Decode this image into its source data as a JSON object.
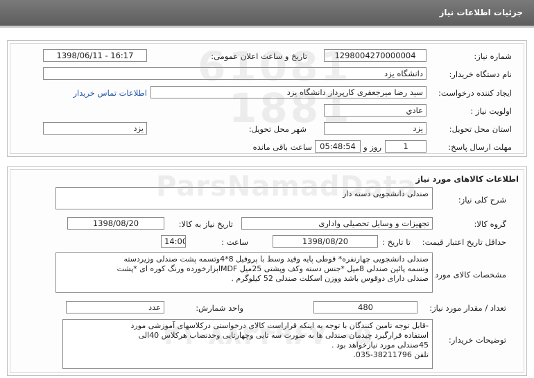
{
  "header": {
    "title": "جزئیات اطلاعات نیاز"
  },
  "info": {
    "need_number_label": "شماره نیاز:",
    "need_number": "1298004270000004",
    "announce_label": "تاریخ و ساعت اعلان عمومی:",
    "announce_value": "1398/06/11 - 16:17",
    "buyer_label": "نام دستگاه خریدار:",
    "buyer_value": "دانشگاه یزد",
    "creator_label": "ایجاد کننده درخواست:",
    "creator_value": "سید رضا میرجعفری کارپرداز دانشگاه یزد",
    "contact_link": "اطلاعات تماس خریدار",
    "priority_label": "اولویت نیاز :",
    "priority_value": "عادي",
    "province_label": "استان محل تحویل:",
    "province_value": "یزد",
    "city_label": "شهر محل تحویل:",
    "city_value": "یزد",
    "deadline_label": "مهلت ارسال پاسخ:",
    "days_value": "1",
    "days_unit": "روز و",
    "time_value": "05:48:54",
    "time_suffix": "ساعت باقی مانده"
  },
  "goods": {
    "section_title": "اطلاعات کالاهای مورد نیاز",
    "summary_label": "شرح کلی نیاز:",
    "summary_value": "صندلی دانشجویی دسته دار",
    "group_label": "گروه کالا:",
    "group_value": "تجهیزات و وسایل تحصیلی واداری",
    "need_date_label": "تاریخ نیاز به کالا:",
    "need_date_value": "1398/08/20",
    "price_validity_label": "حداقل تاریخ اعتبار قیمت:",
    "until_date_label": "تا تاریخ :",
    "until_date_value": "1398/08/20",
    "hour_label": "ساعت :",
    "hour_value": "14:00",
    "specs_label": "مشخصات کالای مورد نیاز:",
    "specs_lines": [
      "صندلی دانشجویی چهارنفره* قوطی پایه وقید وسط با پروفیل 8*4وتسمه پشت صندلی وزیردسته",
      "وتسمه پائین صندلی 8میل *جنس دسته وکف وپشتی 25میل MDFابزارخورده ورنگ کوره ای *پشت",
      "صندلی دارای دوقوس باشد ووزن اسکلت صندلی 52 کیلوگرم ."
    ],
    "qty_label": "تعداد / مقدار مورد نیاز:",
    "qty_value": "480",
    "unit_label": "واحد شمارش:",
    "unit_value": "عدد",
    "buyer_notes_label": "توضیحات خریدار:",
    "notes_lines": [
      "-قابل توجه تامین کنندگان با توجه به اینکه قراراست کالای درخواستی  درکلاسهای آموزشی  مورد",
      "استفاده قرارگیرد چیدمان صندلی ها  به صورت سه تایی وچهارتایی وحدنصاب هرکلاس 40الی",
      "45صندلی مورد نیازخواهد بود .",
      "تلفن 38211796-035."
    ]
  },
  "watermark": {
    "line1": "61081",
    "line2": "1881",
    "line3": "ParsNamadData",
    "line4": "۰۲۱-۸۸۳۴۹۶۷۰-۵"
  }
}
